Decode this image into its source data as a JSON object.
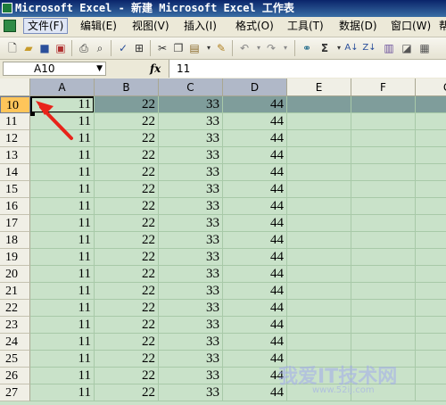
{
  "window": {
    "title": "Microsoft Excel - 新建 Microsoft Excel 工作表"
  },
  "menu": {
    "items": [
      "文件(F)",
      "编辑(E)",
      "视图(V)",
      "插入(I)",
      "格式(O)",
      "工具(T)",
      "数据(D)",
      "窗口(W)",
      "帮"
    ]
  },
  "toolbar": {
    "icons": [
      "new-icon",
      "open-icon",
      "save-icon",
      "permission-icon",
      "print-icon",
      "print-preview-icon",
      "spelling-icon",
      "research-icon",
      "cut-icon",
      "copy-icon",
      "paste-icon",
      "format-painter-icon",
      "undo-icon",
      "redo-icon",
      "hyperlink-icon",
      "autosum-icon",
      "sort-ascending-icon",
      "sort-descending-icon"
    ]
  },
  "formula_bar": {
    "name_box": "A10",
    "fx_label": "fx",
    "value": "11"
  },
  "sheet": {
    "columns": [
      "A",
      "B",
      "C",
      "D",
      "E",
      "F",
      "G"
    ],
    "selected_row": "10",
    "rows": [
      {
        "num": "10",
        "cells": [
          "11",
          "22",
          "33",
          "44"
        ]
      },
      {
        "num": "11",
        "cells": [
          "11",
          "22",
          "33",
          "44"
        ]
      },
      {
        "num": "12",
        "cells": [
          "11",
          "22",
          "33",
          "44"
        ]
      },
      {
        "num": "13",
        "cells": [
          "11",
          "22",
          "33",
          "44"
        ]
      },
      {
        "num": "14",
        "cells": [
          "11",
          "22",
          "33",
          "44"
        ]
      },
      {
        "num": "15",
        "cells": [
          "11",
          "22",
          "33",
          "44"
        ]
      },
      {
        "num": "16",
        "cells": [
          "11",
          "22",
          "33",
          "44"
        ]
      },
      {
        "num": "17",
        "cells": [
          "11",
          "22",
          "33",
          "44"
        ]
      },
      {
        "num": "18",
        "cells": [
          "11",
          "22",
          "33",
          "44"
        ]
      },
      {
        "num": "19",
        "cells": [
          "11",
          "22",
          "33",
          "44"
        ]
      },
      {
        "num": "20",
        "cells": [
          "11",
          "22",
          "33",
          "44"
        ]
      },
      {
        "num": "21",
        "cells": [
          "11",
          "22",
          "33",
          "44"
        ]
      },
      {
        "num": "22",
        "cells": [
          "11",
          "22",
          "33",
          "44"
        ]
      },
      {
        "num": "23",
        "cells": [
          "11",
          "22",
          "33",
          "44"
        ]
      },
      {
        "num": "24",
        "cells": [
          "11",
          "22",
          "33",
          "44"
        ]
      },
      {
        "num": "25",
        "cells": [
          "11",
          "22",
          "33",
          "44"
        ]
      },
      {
        "num": "26",
        "cells": [
          "11",
          "22",
          "33",
          "44"
        ]
      },
      {
        "num": "27",
        "cells": [
          "11",
          "22",
          "33",
          "44"
        ]
      }
    ]
  },
  "annotation": {
    "arrow_color": "#e8231a"
  },
  "watermark": {
    "text": "我爱IT技术网",
    "url": "www.52ij.com"
  },
  "colors": {
    "sheet_bg": "#c9e2c9",
    "selected_row_bg": "#7f9d9b",
    "row_header_selected": "#ffc55a"
  }
}
